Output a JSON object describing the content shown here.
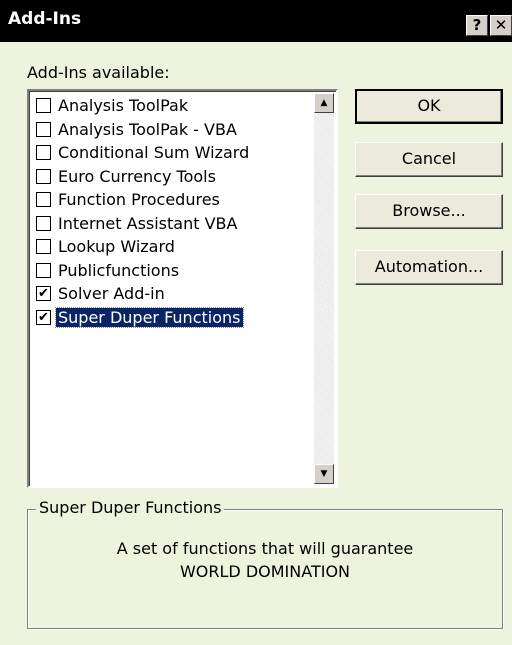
{
  "window": {
    "title": "Add-Ins",
    "help_glyph": "?",
    "close_glyph": "✕"
  },
  "list": {
    "label": "Add-Ins available:",
    "items": [
      {
        "label": "Analysis ToolPak",
        "checked": false,
        "selected": false
      },
      {
        "label": "Analysis ToolPak - VBA",
        "checked": false,
        "selected": false
      },
      {
        "label": "Conditional Sum Wizard",
        "checked": false,
        "selected": false
      },
      {
        "label": "Euro Currency Tools",
        "checked": false,
        "selected": false
      },
      {
        "label": "Function Procedures",
        "checked": false,
        "selected": false
      },
      {
        "label": "Internet Assistant VBA",
        "checked": false,
        "selected": false
      },
      {
        "label": "Lookup Wizard",
        "checked": false,
        "selected": false
      },
      {
        "label": "Publicfunctions",
        "checked": false,
        "selected": false
      },
      {
        "label": "Solver Add-in",
        "checked": true,
        "selected": false
      },
      {
        "label": "Super Duper Functions",
        "checked": true,
        "selected": true
      }
    ],
    "scroll_up_glyph": "▲",
    "scroll_down_glyph": "▼"
  },
  "buttons": {
    "ok": "OK",
    "cancel": "Cancel",
    "browse": "Browse...",
    "automation": "Automation..."
  },
  "description": {
    "title": "Super Duper Functions",
    "text": "A set of functions that will guarantee WORLD DOMINATION"
  },
  "colors": {
    "background": "#eef3dd",
    "titlebar": "#000000",
    "selection": "#0a246a"
  }
}
